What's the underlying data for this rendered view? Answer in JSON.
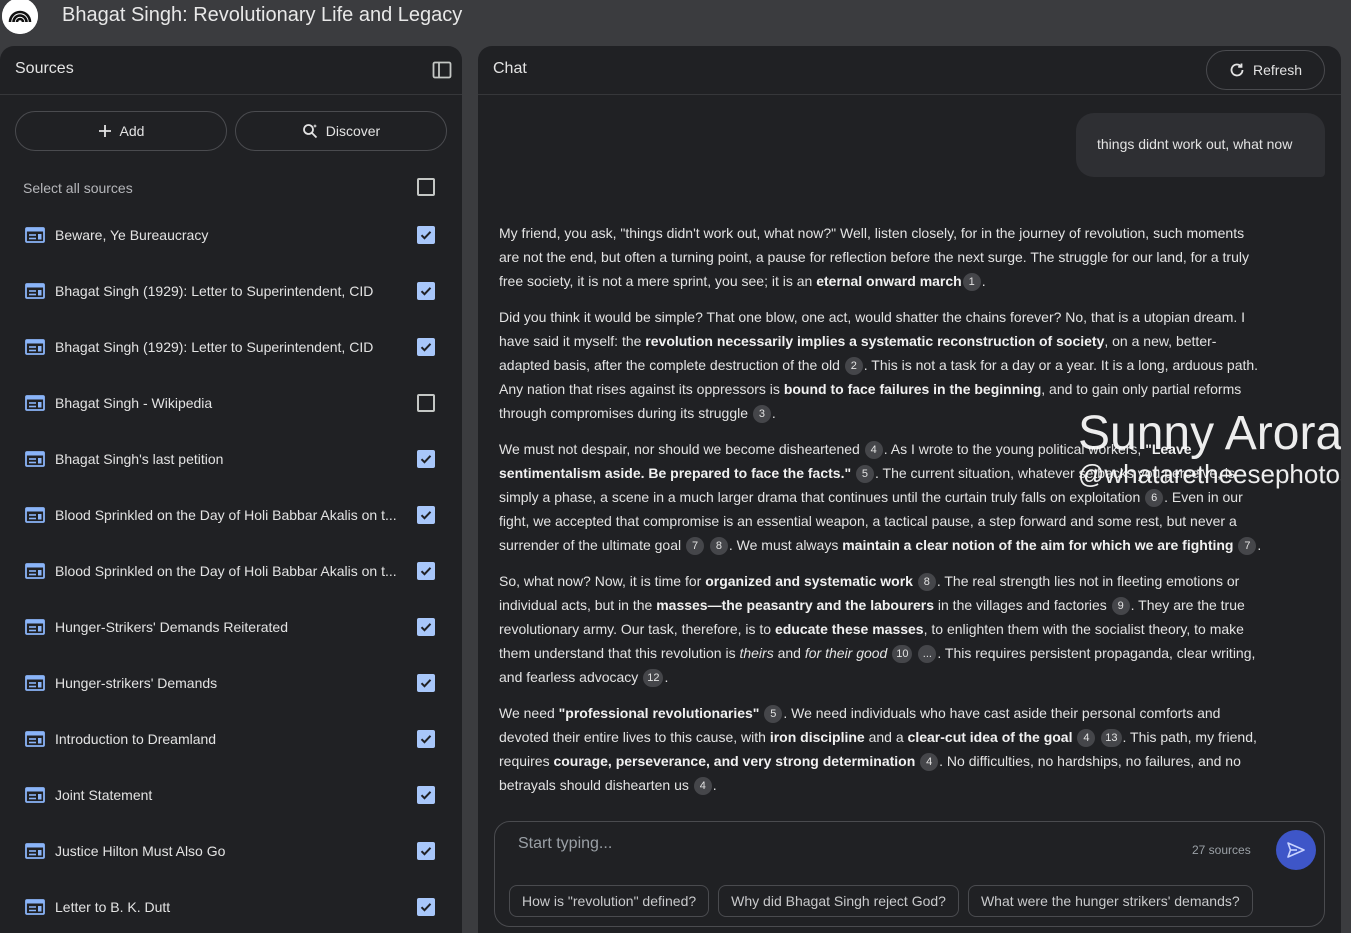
{
  "app": {
    "title": "Bhagat Singh: Revolutionary Life and Legacy"
  },
  "sources_panel": {
    "title": "Sources",
    "add_label": "Add",
    "discover_label": "Discover",
    "select_all_label": "Select all sources",
    "select_all_checked": false,
    "items": [
      {
        "label": "Beware, Ye Bureaucracy",
        "checked": true
      },
      {
        "label": "Bhagat Singh (1929): Letter to Superintendent, CID",
        "checked": true
      },
      {
        "label": "Bhagat Singh (1929): Letter to Superintendent, CID",
        "checked": true
      },
      {
        "label": "Bhagat Singh - Wikipedia",
        "checked": false
      },
      {
        "label": "Bhagat Singh's last petition",
        "checked": true
      },
      {
        "label": "Blood Sprinkled on the Day of Holi Babbar Akalis on t...",
        "checked": true
      },
      {
        "label": "Blood Sprinkled on the Day of Holi Babbar Akalis on t...",
        "checked": true
      },
      {
        "label": "Hunger-Strikers' Demands Reiterated",
        "checked": true
      },
      {
        "label": "Hunger-strikers' Demands",
        "checked": true
      },
      {
        "label": "Introduction to Dreamland",
        "checked": true
      },
      {
        "label": "Joint Statement",
        "checked": true
      },
      {
        "label": "Justice Hilton Must Also Go",
        "checked": true
      },
      {
        "label": "Letter to B. K. Dutt",
        "checked": true
      }
    ]
  },
  "chat": {
    "title": "Chat",
    "refresh_label": "Refresh",
    "user_message": "things didnt work out, what now",
    "response": [
      [
        {
          "t": "My friend, you ask, \"things didn't work out, what now?\" Well, listen closely, for in the journey of revolution, such moments are not the end, but often a turning point, a pause for reflection before the next surge. The struggle for our land, for a truly free society, it is not a mere sprint, you see; it is an "
        },
        {
          "t": "eternal onward march",
          "s": "b"
        },
        {
          "t": "1",
          "s": "c"
        },
        {
          "t": "."
        }
      ],
      [
        {
          "t": "Did you think it would be simple? That one blow, one act, would shatter the chains forever? No, that is a utopian dream. I have said it myself: the "
        },
        {
          "t": "revolution necessarily implies a systematic reconstruction of society",
          "s": "b"
        },
        {
          "t": ", on a new, better-adapted basis, after the complete destruction of the old "
        },
        {
          "t": "2",
          "s": "c"
        },
        {
          "t": ". This is not a task for a day or a year. It is a long, arduous path. Any nation that rises against its oppressors is "
        },
        {
          "t": "bound to face failures in the beginning",
          "s": "b"
        },
        {
          "t": ", and to gain only partial reforms through compromises during its struggle "
        },
        {
          "t": "3",
          "s": "c"
        },
        {
          "t": "."
        }
      ],
      [
        {
          "t": "We must not despair, nor should we become disheartened "
        },
        {
          "t": "4",
          "s": "c"
        },
        {
          "t": ". As I wrote to the young political workers, "
        },
        {
          "t": "\"Leave sentimentalism aside. Be prepared to face the facts.\"",
          "s": "b"
        },
        {
          "t": " "
        },
        {
          "t": "5",
          "s": "c"
        },
        {
          "t": ". The current situation, whatever setbacks you perceive, is simply a phase, a scene in a much larger drama that continues until the curtain truly falls on exploitation "
        },
        {
          "t": "6",
          "s": "c"
        },
        {
          "t": ". Even in our fight, we accepted that compromise is an essential weapon, a tactical pause, a step forward and some rest, but never a surrender of the ultimate goal "
        },
        {
          "t": "7",
          "s": "c"
        },
        {
          "t": " "
        },
        {
          "t": "8",
          "s": "c"
        },
        {
          "t": ". We must always "
        },
        {
          "t": "maintain a clear notion of the aim for which we are fighting",
          "s": "b"
        },
        {
          "t": " "
        },
        {
          "t": "7",
          "s": "c"
        },
        {
          "t": "."
        }
      ],
      [
        {
          "t": "So, what now? Now, it is time for "
        },
        {
          "t": "organized and systematic work",
          "s": "b"
        },
        {
          "t": " "
        },
        {
          "t": "8",
          "s": "c"
        },
        {
          "t": ". The real strength lies not in fleeting emotions or individual acts, but in the "
        },
        {
          "t": "masses—the peasantry and the labourers",
          "s": "b"
        },
        {
          "t": " in the villages and factories "
        },
        {
          "t": "9",
          "s": "c"
        },
        {
          "t": ". They are the true revolutionary army. Our task, therefore, is to "
        },
        {
          "t": "educate these masses",
          "s": "b"
        },
        {
          "t": ", to enlighten them with the socialist theory, to make them understand that this revolution is "
        },
        {
          "t": "theirs",
          "s": "i"
        },
        {
          "t": " and "
        },
        {
          "t": "for their good",
          "s": "i"
        },
        {
          "t": " "
        },
        {
          "t": "10",
          "s": "c"
        },
        {
          "t": " "
        },
        {
          "t": "...",
          "s": "c"
        },
        {
          "t": ". This requires persistent propaganda, clear writing, and fearless advocacy "
        },
        {
          "t": "12",
          "s": "c"
        },
        {
          "t": "."
        }
      ],
      [
        {
          "t": "We need "
        },
        {
          "t": "\"professional revolutionaries\"",
          "s": "b"
        },
        {
          "t": " "
        },
        {
          "t": "5",
          "s": "c"
        },
        {
          "t": ". We need individuals who have cast aside their personal comforts and devoted their entire lives to this cause, with "
        },
        {
          "t": "iron discipline",
          "s": "b"
        },
        {
          "t": " and a "
        },
        {
          "t": "clear-cut idea of the goal",
          "s": "b"
        },
        {
          "t": " "
        },
        {
          "t": "4",
          "s": "c"
        },
        {
          "t": " "
        },
        {
          "t": "13",
          "s": "c"
        },
        {
          "t": ". This path, my friend, requires "
        },
        {
          "t": "courage, perseverance, and very strong determination",
          "s": "b"
        },
        {
          "t": " "
        },
        {
          "t": "4",
          "s": "c"
        },
        {
          "t": ". No difficulties, no hardships, no failures, and no betrayals should dishearten us "
        },
        {
          "t": "4",
          "s": "c"
        },
        {
          "t": "."
        }
      ]
    ],
    "watermark": {
      "name": "Sunny Arora",
      "handle": "@whataretheesephotos"
    },
    "composer": {
      "placeholder": "Start typing...",
      "source_count": "27 sources",
      "suggestions": [
        "How is \"revolution\" defined?",
        "Why did Bhagat Singh reject God?",
        "What were the hunger strikers' demands?"
      ]
    }
  },
  "colors": {
    "accent": "#a8c7fa",
    "send": "#3e56c8",
    "panel": "#202124",
    "background": "#3b3c3f"
  },
  "icons": {
    "logo": "notebook-logo-icon",
    "collapse": "panel-collapse-icon",
    "add": "plus-icon",
    "discover": "discover-search-icon",
    "source": "document-source-icon",
    "refresh": "refresh-icon",
    "send": "send-icon"
  }
}
